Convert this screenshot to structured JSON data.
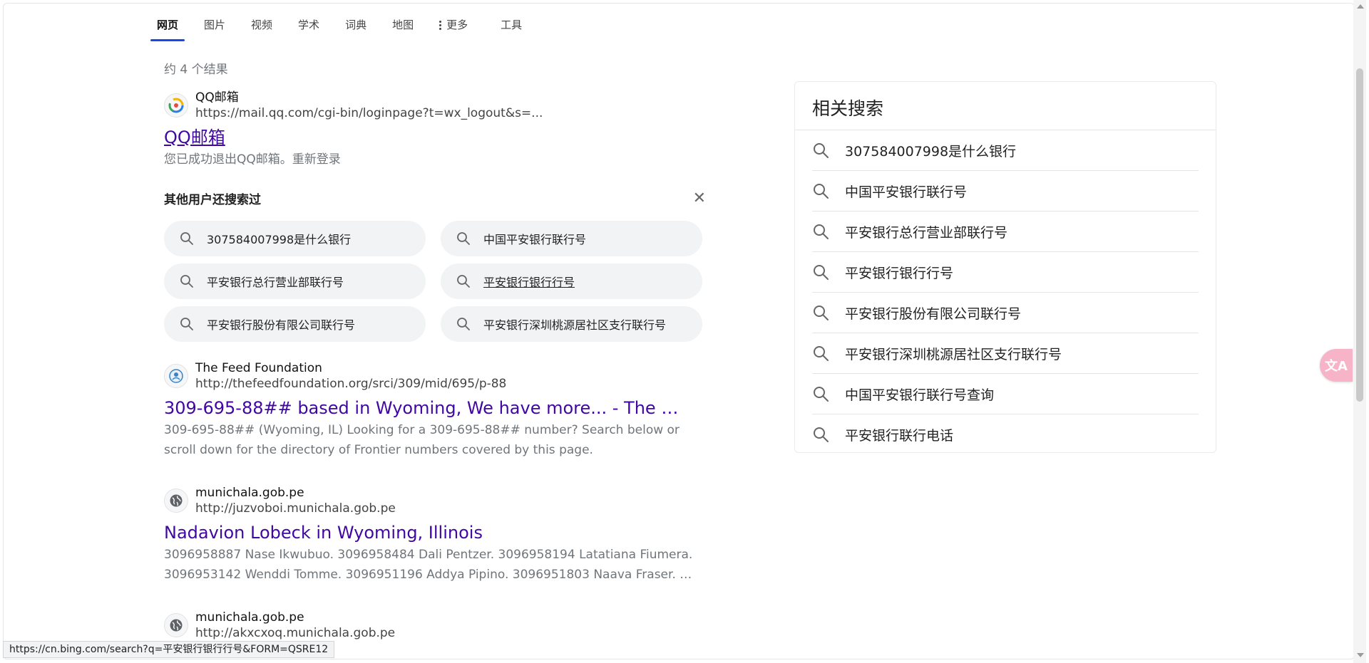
{
  "tabs": [
    {
      "label": "网页"
    },
    {
      "label": "图片"
    },
    {
      "label": "视频"
    },
    {
      "label": "学术"
    },
    {
      "label": "词典"
    },
    {
      "label": "地图"
    },
    {
      "label": "更多"
    },
    {
      "label": "工具"
    }
  ],
  "results_count": "约 4 个结果",
  "results": [
    {
      "site_name": "QQ邮箱",
      "url": "https://mail.qq.com/cgi-bin/loginpage?t=wx_logout&s=...",
      "title": "QQ邮箱",
      "snippet": "您已成功退出QQ邮箱。重新登录",
      "icon": "qq-mail-icon"
    },
    {
      "site_name": "The Feed Foundation",
      "url": "http://thefeedfoundation.org/srci/309/mid/695/p-88",
      "title": "309-695-88## based in Wyoming, We have more... - The …",
      "snippet": "309-695-88## (Wyoming, IL) Looking for a 309-695-88## number? Search below or scroll down for the directory of Frontier numbers covered by this page.",
      "icon": "feed-foundation-icon"
    },
    {
      "site_name": "munichala.gob.pe",
      "url": "http://juzvoboi.munichala.gob.pe",
      "title": "Nadavion Lobeck in Wyoming, Illinois",
      "snippet": "3096958887 Nase Ikwubuo. 3096958484 Dali Pentzer. 3096958194 Latatiana Fiumera. 3096953142 Wenddi Tomme. 3096951196 Addya Pipino. 3096951803 Naava Fraser. …",
      "icon": "globe-icon"
    },
    {
      "site_name": "munichala.gob.pe",
      "url": "http://akxcxoq.munichala.gob.pe",
      "title": "",
      "snippet": "",
      "icon": "globe-icon"
    }
  ],
  "also_searched": {
    "title": "其他用户还搜索过",
    "items": [
      "307584007998是什么银行",
      "中国平安银行联行号",
      "平安银行总行营业部联行号",
      "平安银行银行行号",
      "平安银行股份有限公司联行号",
      "平安银行深圳桃源居社区支行联行号"
    ]
  },
  "related": {
    "title": "相关搜索",
    "items": [
      "307584007998是什么银行",
      "中国平安银行联行号",
      "平安银行总行营业部联行号",
      "平安银行银行行号",
      "平安银行股份有限公司联行号",
      "平安银行深圳桃源居社区支行联行号",
      "中国平安银行联行号查询",
      "平安银行联行电话"
    ]
  },
  "status_url": "https://cn.bing.com/search?q=平安银行银行行号&FORM=QSRE12",
  "colors": {
    "accent": "#174ae4",
    "link": "#4007a2",
    "translate": "#f7b4c9"
  }
}
